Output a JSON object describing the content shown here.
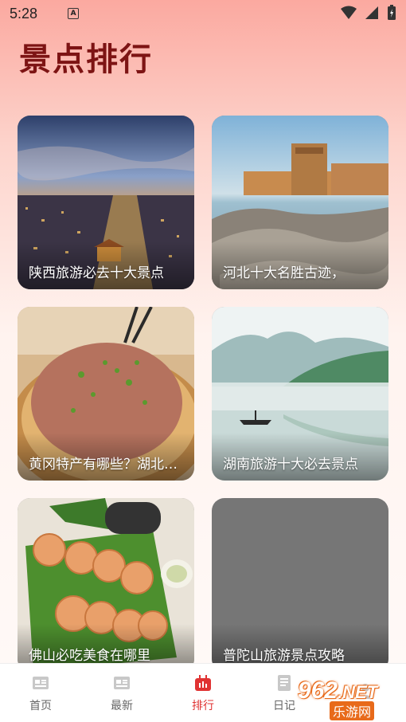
{
  "status_bar": {
    "time": "5:28",
    "a_badge": "A"
  },
  "page_title": "景点排行",
  "cards": [
    {
      "caption": "陕西旅游必去十大景点"
    },
    {
      "caption": "河北十大名胜古迹，"
    },
    {
      "caption": "黄冈特产有哪些？湖北黄冈特产"
    },
    {
      "caption": "湖南旅游十大必去景点"
    },
    {
      "caption": "佛山必吃美食在哪里"
    },
    {
      "caption": "普陀山旅游景点攻略"
    }
  ],
  "tabs": [
    {
      "label": "首页",
      "icon": "home-icon"
    },
    {
      "label": "最新",
      "icon": "news-icon"
    },
    {
      "label": "排行",
      "icon": "ranking-icon"
    },
    {
      "label": "日记",
      "icon": "diary-icon"
    },
    {
      "label": "",
      "icon": "profile-icon"
    }
  ],
  "watermark": {
    "top": "962",
    "dot": ".NET",
    "bottom": "乐游网"
  },
  "colors": {
    "title": "#7d1414",
    "active_tab": "#e03333",
    "inactive_tab": "#666666"
  }
}
